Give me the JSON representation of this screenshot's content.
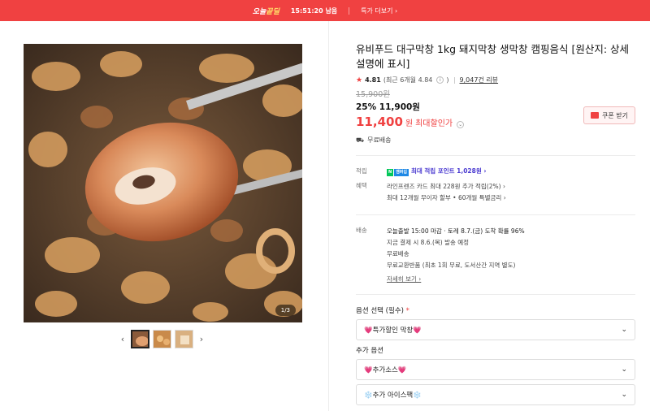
{
  "topbar": {
    "brand_a": "오늘",
    "brand_b": "끝딜",
    "timer": "15:51:20 남음",
    "more": "특가 더보기 ›"
  },
  "gallery": {
    "counter": "1/3",
    "prev_icon": "chevron-left-icon",
    "next_icon": "chevron-right-icon"
  },
  "product": {
    "title": "유비푸드 대구막창 1kg 돼지막창 생막창 캠핑음식 [원산지: 상세설명에 표시]",
    "rating": "4.81",
    "rating_recent": "(최근 6개월 4.84",
    "reviews": "9,047건 리뷰",
    "original_price": "15,900원",
    "discount_price": "25% 11,900원",
    "final_price": "11,400",
    "won": "원",
    "max_discount_label": "최대할인가",
    "coupon": "쿠폰 받기",
    "shipping": "무료배송"
  },
  "benefits": {
    "points_label": "적립",
    "points_badge_n": "N",
    "points_badge_p": "멤버십",
    "points_text": "최대 적립 포인트 1,028원 ›",
    "benefit_label": "혜택",
    "benefit_1": "라인프렌즈 카드 최대 228원 추가 적립(2%) ›",
    "benefit_2": "최대 12개월 무이자 할부 • 60개월 특별금리 ›"
  },
  "delivery": {
    "label": "배송",
    "line_1": "오늘출발 15:00 마감 · 토레 8.7.(금) 도착 확률 96%",
    "line_2": "지금 결제 시 8.6.(목) 발송 예정",
    "line_3": "무료배송",
    "line_4": "무료교환반품 (최초 1회 무료, 도서산간 지역 별도)",
    "detail_link": "자세히 보기 ›"
  },
  "options": {
    "required_label": "옵션 선택 (필수)",
    "required_mark": "*",
    "required_value": "💗특가할인 막창💗",
    "extra_label": "추가 옵션",
    "extra_1": "💗추가소스💗",
    "extra_2": "❄️추가 아이스팩❄️"
  },
  "colors": {
    "accent": "#f04141",
    "points": "#4a3ad0"
  }
}
